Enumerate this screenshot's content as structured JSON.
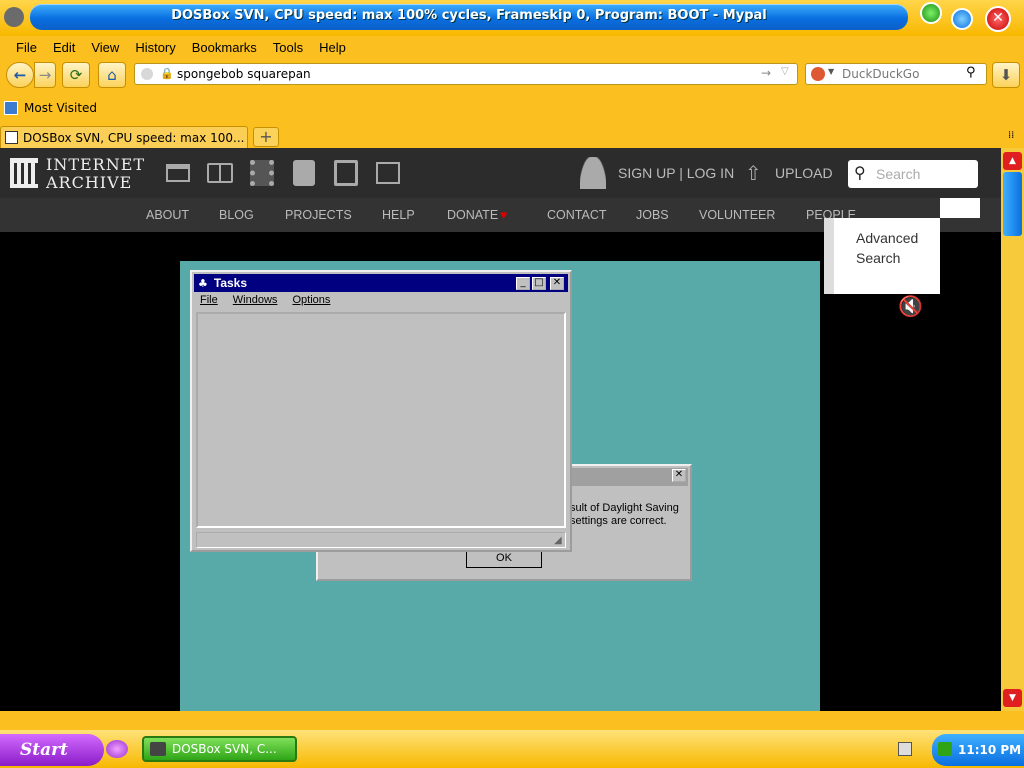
{
  "window": {
    "title": "DOSBox SVN, CPU speed: max 100% cycles, Frameskip 0, Program: BOOT - Mypal"
  },
  "menu": [
    "File",
    "Edit",
    "View",
    "History",
    "Bookmarks",
    "Tools",
    "Help"
  ],
  "nav": {
    "url": "spongebob squarepan",
    "search_placeholder": "DuckDuckGo"
  },
  "bookmarks": {
    "most_visited": "Most Visited"
  },
  "tabs": [
    {
      "label": "DOSBox SVN, CPU speed: max 100..."
    }
  ],
  "ia": {
    "logo_line1": "INTERNET",
    "logo_line2": "ARCHIVE",
    "signup_login": "SIGN UP | LOG IN",
    "upload": "UPLOAD",
    "search_placeholder": "Search",
    "nav": [
      "ABOUT",
      "BLOG",
      "PROJECTS",
      "HELP",
      "DONATE",
      "CONTACT",
      "JOBS",
      "VOLUNTEER",
      "PEOPLE"
    ],
    "advanced_search_line1": "Advanced",
    "advanced_search_line2": "Search"
  },
  "tasks_window": {
    "title": "Tasks",
    "menu": [
      "File",
      "Windows",
      "Options"
    ]
  },
  "dialog": {
    "text_line1": "sult of Daylight Saving",
    "text_line2": "settings are correct.",
    "ok_label": "OK"
  },
  "taskbar": {
    "start_label": "Start",
    "task_label": "DOSBox SVN, C...",
    "clock": "11:10 PM"
  },
  "colors": {
    "theme": "#fbbf20",
    "title_blue": "#0a6fe0",
    "ia_dark": "#2c2c2c",
    "dos_teal": "#58aaa8",
    "win95_title": "#000080"
  }
}
